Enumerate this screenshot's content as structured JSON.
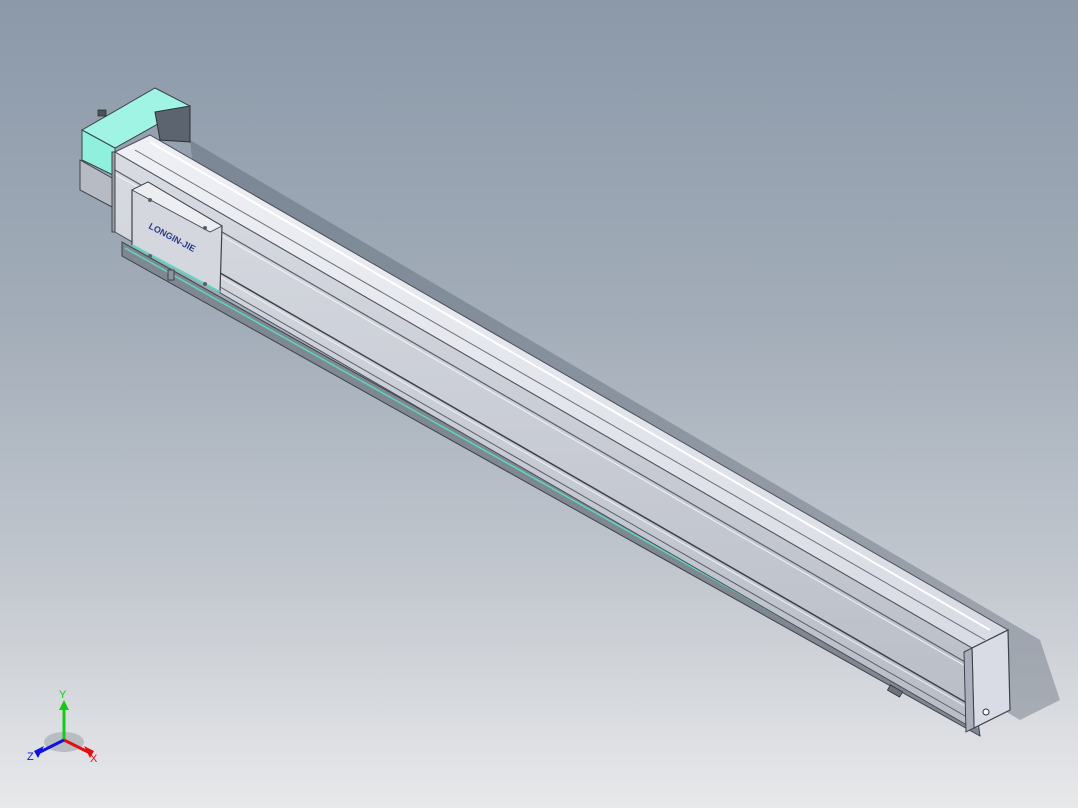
{
  "viewport": {
    "background_top": "#8b99a9",
    "background_bottom": "#e8e9eb"
  },
  "model": {
    "part": "linear-actuator-module",
    "carriage_engraving": "LONGIN-JIE",
    "colors": {
      "rail_face": "#c9ccd3",
      "rail_top": "#e6e8ee",
      "rail_edge": "#4b4e58",
      "motor_housing": "#8ff0de",
      "motor_shadow": "#5fc4b4",
      "carriage": "#d4d7dd",
      "logo": "#2a3c8c",
      "end_cap": "#d9dce4"
    }
  },
  "triad": {
    "labels": {
      "x": "X",
      "y": "Y",
      "z": "Z"
    },
    "colors": {
      "x": "#e01010",
      "y": "#18c818",
      "z": "#1010e0"
    }
  }
}
